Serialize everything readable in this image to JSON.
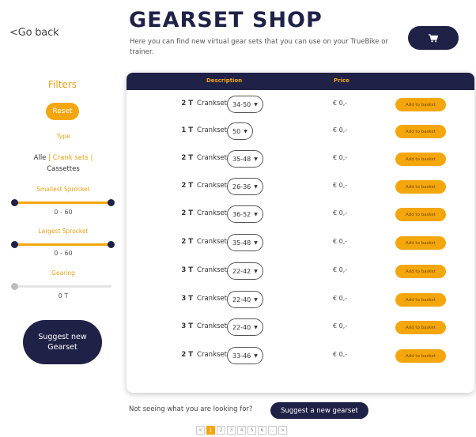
{
  "header": {
    "back_label": "<Go back",
    "title": "GEARSET SHOP",
    "subtitle": "Here you can find new virtual gear sets that you can use on your TrueBike or trainer.",
    "cart_icon": "cart-icon"
  },
  "sidebar": {
    "filters_title": "Filters",
    "reset_label": "Reset",
    "type_label": "Type",
    "type_all": "Alle",
    "type_cranksets": "Crank sets |",
    "type_cassettes": "Cassettes",
    "smallest_label": "Smallest Sprocket",
    "smallest_range": "0 - 60",
    "largest_label": "Largest Sprocket",
    "largest_range": "0 - 60",
    "gearing_label": "Gearing",
    "gearing_value": "0 T",
    "suggest_line1": "Suggest new",
    "suggest_line2": "Gearset"
  },
  "table": {
    "col_description": "Description",
    "col_price": "Price",
    "rows": [
      {
        "teeth": "2 T",
        "type": "Crankset",
        "size": "34-50",
        "price": "€ 0,-",
        "action": "Add to basket"
      },
      {
        "teeth": "1 T",
        "type": "Crankset",
        "size": "50",
        "price": "€ 0,-",
        "action": "Add to basket"
      },
      {
        "teeth": "2 T",
        "type": "Crankset",
        "size": "35-48",
        "price": "€ 0,-",
        "action": "Add to basket"
      },
      {
        "teeth": "2 T",
        "type": "Crankset",
        "size": "26-36",
        "price": "€ 0,-",
        "action": "Add to basket"
      },
      {
        "teeth": "2 T",
        "type": "Crankset",
        "size": "36-52",
        "price": "€ 0,-",
        "action": "Add to basket"
      },
      {
        "teeth": "2 T",
        "type": "Crankset",
        "size": "35-48",
        "price": "€ 0,-",
        "action": "Add to basket"
      },
      {
        "teeth": "3 T",
        "type": "Crankset",
        "size": "22-42",
        "price": "€ 0,-",
        "action": "Add to basket"
      },
      {
        "teeth": "3 T",
        "type": "Crankset",
        "size": "22-40",
        "price": "€ 0,-",
        "action": "Add to basket"
      },
      {
        "teeth": "3 T",
        "type": "Crankset",
        "size": "22-40",
        "price": "€ 0,-",
        "action": "Add to basket"
      },
      {
        "teeth": "2 T",
        "type": "Crankset",
        "size": "33-46",
        "price": "€ 0,-",
        "action": "Add to basket"
      }
    ]
  },
  "footer": {
    "not_seeing": "Not seeing what you are looking for?",
    "suggest_label": "Suggest a new gearset",
    "pages": [
      "<",
      "1",
      "2",
      "3",
      "4",
      "5",
      "6",
      "...",
      ">"
    ],
    "active_page": "1"
  },
  "colors": {
    "navy": "#1f2147",
    "accent": "#f4a60d"
  }
}
